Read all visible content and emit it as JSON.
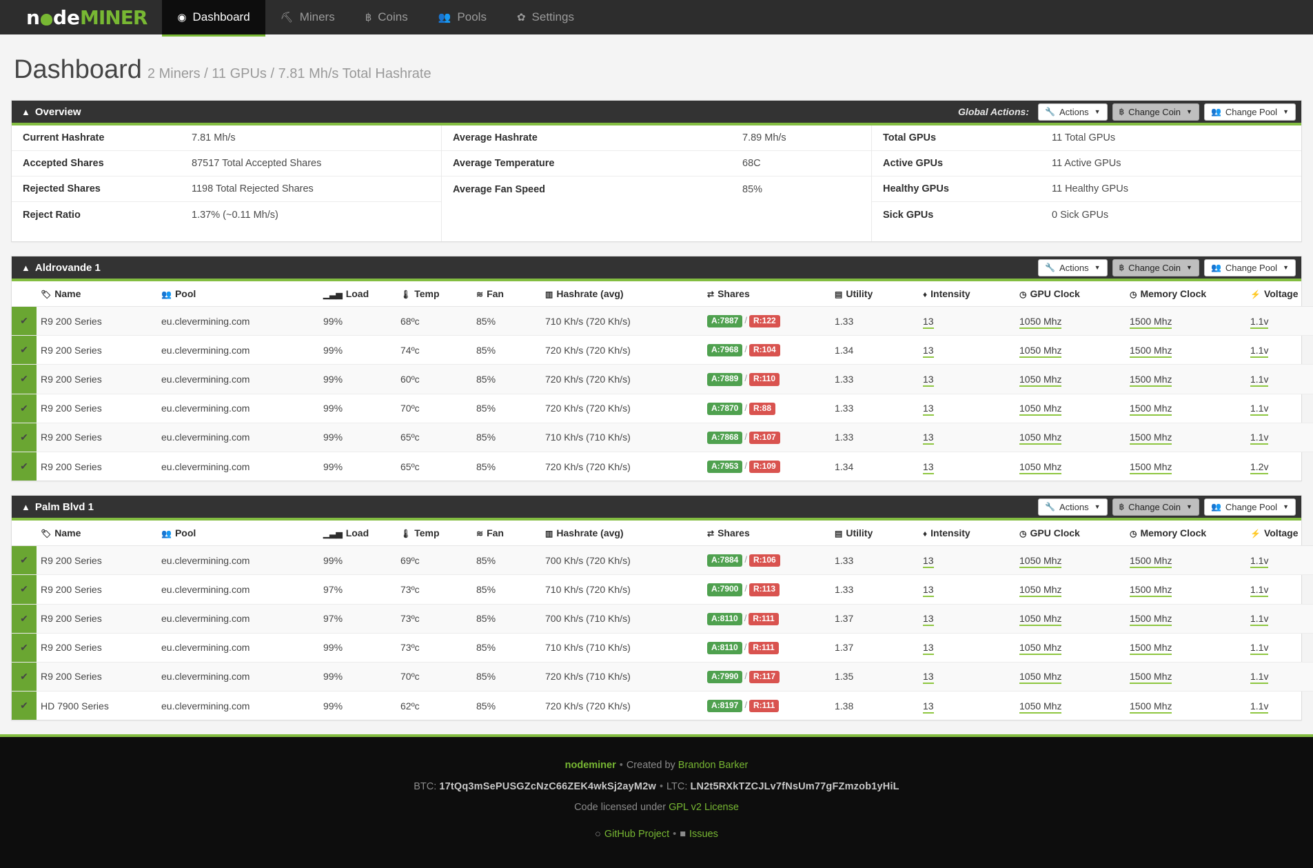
{
  "nav": {
    "brand": {
      "part1": "n",
      "part2": "de",
      "part3": "MINER"
    },
    "items": [
      {
        "label": "Dashboard",
        "icon": "dashboard-icon",
        "glyph": "◉",
        "active": true
      },
      {
        "label": "Miners",
        "icon": "pickaxe-icon",
        "glyph": "⛏",
        "active": false
      },
      {
        "label": "Coins",
        "icon": "bitcoin-icon",
        "glyph": "฿",
        "active": false
      },
      {
        "label": "Pools",
        "icon": "users-icon",
        "glyph": "👥",
        "active": false
      },
      {
        "label": "Settings",
        "icon": "gear-icon",
        "glyph": "✿",
        "active": false
      }
    ]
  },
  "page": {
    "title": "Dashboard",
    "subtitle": "2 Miners / 11 GPUs / 7.81 Mh/s Total Hashrate"
  },
  "overview": {
    "title": "Overview",
    "global_actions_label": "Global Actions:",
    "buttons": [
      {
        "label": "Actions",
        "icon": "wrench-icon",
        "glyph": "🔧",
        "style": "white"
      },
      {
        "label": "Change Coin",
        "icon": "bitcoin-icon",
        "glyph": "฿",
        "style": "grey"
      },
      {
        "label": "Change Pool",
        "icon": "users-icon",
        "glyph": "👥",
        "style": "white"
      }
    ],
    "columns": [
      [
        {
          "key": "Current Hashrate",
          "value": "7.81 Mh/s"
        },
        {
          "key": "Accepted Shares",
          "value": "87517 Total Accepted Shares"
        },
        {
          "key": "Rejected Shares",
          "value": "1198 Total Rejected Shares"
        },
        {
          "key": "Reject Ratio",
          "value": "1.37% (~0.11 Mh/s)"
        }
      ],
      [
        {
          "key": "Average Hashrate",
          "value": "7.89 Mh/s"
        },
        {
          "key": "Average Temperature",
          "value": "68C"
        },
        {
          "key": "Average Fan Speed",
          "value": "85%"
        }
      ],
      [
        {
          "key": "Total GPUs",
          "value": "11 Total GPUs"
        },
        {
          "key": "Active GPUs",
          "value": "11 Active GPUs"
        },
        {
          "key": "Healthy GPUs",
          "value": "11 Healthy GPUs"
        },
        {
          "key": "Sick GPUs",
          "value": "0 Sick GPUs"
        }
      ]
    ]
  },
  "table_headers": [
    {
      "label": "Name",
      "icon": "tag-icon",
      "glyph": "🏷"
    },
    {
      "label": "Pool",
      "icon": "users-icon",
      "glyph": "👥"
    },
    {
      "label": "Load",
      "icon": "signal-icon",
      "glyph": "▁▃▅"
    },
    {
      "label": "Temp",
      "icon": "thermometer-icon",
      "glyph": "🌡"
    },
    {
      "label": "Fan",
      "icon": "wifi-icon",
      "glyph": "≋"
    },
    {
      "label": "Hashrate (avg)",
      "icon": "bar-chart-icon",
      "glyph": "▥"
    },
    {
      "label": "Shares",
      "icon": "exchange-icon",
      "glyph": "⇄"
    },
    {
      "label": "Utility",
      "icon": "desktop-icon",
      "glyph": "▤"
    },
    {
      "label": "Intensity",
      "icon": "tint-icon",
      "glyph": "♦"
    },
    {
      "label": "GPU Clock",
      "icon": "clock-icon",
      "glyph": "◷"
    },
    {
      "label": "Memory Clock",
      "icon": "clock-icon",
      "glyph": "◷"
    },
    {
      "label": "Voltage",
      "icon": "bolt-icon",
      "glyph": "⚡"
    }
  ],
  "miners": [
    {
      "title": "Aldrovande 1",
      "buttons": [
        {
          "label": "Actions",
          "icon": "wrench-icon",
          "glyph": "🔧",
          "style": "white"
        },
        {
          "label": "Change Coin",
          "icon": "bitcoin-icon",
          "glyph": "฿",
          "style": "grey"
        },
        {
          "label": "Change Pool",
          "icon": "users-icon",
          "glyph": "👥",
          "style": "white"
        }
      ],
      "rows": [
        {
          "status": "✔",
          "name": "R9 200 Series",
          "pool": "eu.clevermining.com",
          "load": "99%",
          "temp": "68ºc",
          "fan": "85%",
          "hashrate": "710 Kh/s (720 Kh/s)",
          "accepted": "A:7887",
          "rejected": "R:122",
          "utility": "1.33",
          "intensity": "13",
          "gpu_clock": "1050 Mhz",
          "memory_clock": "1500 Mhz",
          "voltage": "1.1v"
        },
        {
          "status": "✔",
          "name": "R9 200 Series",
          "pool": "eu.clevermining.com",
          "load": "99%",
          "temp": "74ºc",
          "fan": "85%",
          "hashrate": "720 Kh/s (720 Kh/s)",
          "accepted": "A:7968",
          "rejected": "R:104",
          "utility": "1.34",
          "intensity": "13",
          "gpu_clock": "1050 Mhz",
          "memory_clock": "1500 Mhz",
          "voltage": "1.1v"
        },
        {
          "status": "✔",
          "name": "R9 200 Series",
          "pool": "eu.clevermining.com",
          "load": "99%",
          "temp": "60ºc",
          "fan": "85%",
          "hashrate": "720 Kh/s (720 Kh/s)",
          "accepted": "A:7889",
          "rejected": "R:110",
          "utility": "1.33",
          "intensity": "13",
          "gpu_clock": "1050 Mhz",
          "memory_clock": "1500 Mhz",
          "voltage": "1.1v"
        },
        {
          "status": "✔",
          "name": "R9 200 Series",
          "pool": "eu.clevermining.com",
          "load": "99%",
          "temp": "70ºc",
          "fan": "85%",
          "hashrate": "720 Kh/s (720 Kh/s)",
          "accepted": "A:7870",
          "rejected": "R:88",
          "utility": "1.33",
          "intensity": "13",
          "gpu_clock": "1050 Mhz",
          "memory_clock": "1500 Mhz",
          "voltage": "1.1v"
        },
        {
          "status": "✔",
          "name": "R9 200 Series",
          "pool": "eu.clevermining.com",
          "load": "99%",
          "temp": "65ºc",
          "fan": "85%",
          "hashrate": "710 Kh/s (710 Kh/s)",
          "accepted": "A:7868",
          "rejected": "R:107",
          "utility": "1.33",
          "intensity": "13",
          "gpu_clock": "1050 Mhz",
          "memory_clock": "1500 Mhz",
          "voltage": "1.1v"
        },
        {
          "status": "✔",
          "name": "R9 200 Series",
          "pool": "eu.clevermining.com",
          "load": "99%",
          "temp": "65ºc",
          "fan": "85%",
          "hashrate": "720 Kh/s (720 Kh/s)",
          "accepted": "A:7953",
          "rejected": "R:109",
          "utility": "1.34",
          "intensity": "13",
          "gpu_clock": "1050 Mhz",
          "memory_clock": "1500 Mhz",
          "voltage": "1.2v"
        }
      ]
    },
    {
      "title": "Palm Blvd 1",
      "buttons": [
        {
          "label": "Actions",
          "icon": "wrench-icon",
          "glyph": "🔧",
          "style": "white"
        },
        {
          "label": "Change Coin",
          "icon": "bitcoin-icon",
          "glyph": "฿",
          "style": "grey"
        },
        {
          "label": "Change Pool",
          "icon": "users-icon",
          "glyph": "👥",
          "style": "white"
        }
      ],
      "rows": [
        {
          "status": "✔",
          "name": "R9 200 Series",
          "pool": "eu.clevermining.com",
          "load": "99%",
          "temp": "69ºc",
          "fan": "85%",
          "hashrate": "700 Kh/s (720 Kh/s)",
          "accepted": "A:7884",
          "rejected": "R:106",
          "utility": "1.33",
          "intensity": "13",
          "gpu_clock": "1050 Mhz",
          "memory_clock": "1500 Mhz",
          "voltage": "1.1v"
        },
        {
          "status": "✔",
          "name": "R9 200 Series",
          "pool": "eu.clevermining.com",
          "load": "97%",
          "temp": "73ºc",
          "fan": "85%",
          "hashrate": "710 Kh/s (720 Kh/s)",
          "accepted": "A:7900",
          "rejected": "R:113",
          "utility": "1.33",
          "intensity": "13",
          "gpu_clock": "1050 Mhz",
          "memory_clock": "1500 Mhz",
          "voltage": "1.1v"
        },
        {
          "status": "✔",
          "name": "R9 200 Series",
          "pool": "eu.clevermining.com",
          "load": "97%",
          "temp": "73ºc",
          "fan": "85%",
          "hashrate": "700 Kh/s (710 Kh/s)",
          "accepted": "A:8110",
          "rejected": "R:111",
          "utility": "1.37",
          "intensity": "13",
          "gpu_clock": "1050 Mhz",
          "memory_clock": "1500 Mhz",
          "voltage": "1.1v"
        },
        {
          "status": "✔",
          "name": "R9 200 Series",
          "pool": "eu.clevermining.com",
          "load": "99%",
          "temp": "73ºc",
          "fan": "85%",
          "hashrate": "710 Kh/s (710 Kh/s)",
          "accepted": "A:8110",
          "rejected": "R:111",
          "utility": "1.37",
          "intensity": "13",
          "gpu_clock": "1050 Mhz",
          "memory_clock": "1500 Mhz",
          "voltage": "1.1v"
        },
        {
          "status": "✔",
          "name": "R9 200 Series",
          "pool": "eu.clevermining.com",
          "load": "99%",
          "temp": "70ºc",
          "fan": "85%",
          "hashrate": "720 Kh/s (710 Kh/s)",
          "accepted": "A:7990",
          "rejected": "R:117",
          "utility": "1.35",
          "intensity": "13",
          "gpu_clock": "1050 Mhz",
          "memory_clock": "1500 Mhz",
          "voltage": "1.1v"
        },
        {
          "status": "✔",
          "name": "HD 7900 Series",
          "pool": "eu.clevermining.com",
          "load": "99%",
          "temp": "62ºc",
          "fan": "85%",
          "hashrate": "720 Kh/s (720 Kh/s)",
          "accepted": "A:8197",
          "rejected": "R:111",
          "utility": "1.38",
          "intensity": "13",
          "gpu_clock": "1050 Mhz",
          "memory_clock": "1500 Mhz",
          "voltage": "1.1v"
        }
      ]
    }
  ],
  "footer": {
    "app_name": "nodeminer",
    "created_by_text": "Created by",
    "author": "Brandon Barker",
    "btc_label": "BTC:",
    "btc_address": "17tQq3mSePUSGZcNzC66ZEK4wkSj2ayM2w",
    "ltc_label": "LTC:",
    "ltc_address": "LN2t5RXkTZCJLv7fNsUm77gFZmzob1yHiL",
    "license_text": "Code licensed under",
    "license_link": "GPL v2 License",
    "github_link": "GitHub Project",
    "issues_link": "Issues"
  },
  "colors": {
    "brand_green": "#78b833",
    "panel_green": "#83bd41",
    "dark": "#2d2d2d",
    "badge_ok": "#4fa14f",
    "badge_bad": "#d9534f"
  }
}
